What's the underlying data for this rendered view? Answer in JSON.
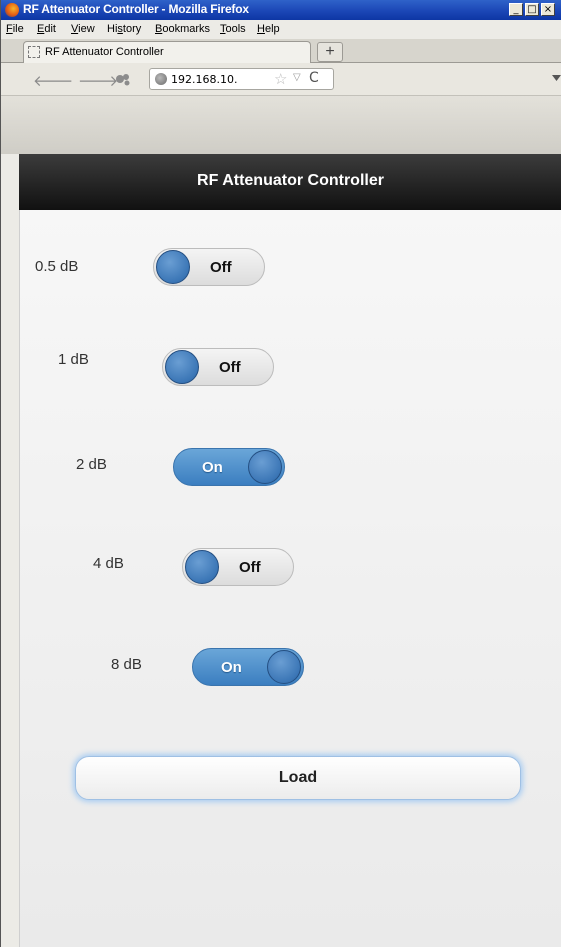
{
  "window": {
    "title": "RF Attenuator Controller - Mozilla Firefox",
    "controls": [
      "_",
      "□",
      "×"
    ]
  },
  "menubar": {
    "items": [
      {
        "first": "F",
        "rest": "ile"
      },
      {
        "first": "E",
        "rest": "dit"
      },
      {
        "first": "V",
        "rest": "iew"
      },
      {
        "first": "Hi",
        "u": "s",
        "rest": "tory"
      },
      {
        "first": "B",
        "rest": "ookmarks"
      },
      {
        "first": "T",
        "rest": "ools"
      },
      {
        "first": "H",
        "rest": "elp"
      }
    ]
  },
  "tabs": {
    "active_tab": "RF Attenuator Controller",
    "new_tab": "+"
  },
  "navbar": {
    "back_icon": "🡐",
    "forward_icon": "🡒",
    "url": "192.168.10.",
    "star_icon": "☆",
    "dropdown_icon": "▽",
    "reload_icon": "C"
  },
  "page": {
    "header_title": "RF Attenuator Controller",
    "attenuators": [
      {
        "label": "0.5 dB",
        "state": "Off"
      },
      {
        "label": "1 dB",
        "state": "Off"
      },
      {
        "label": "2 dB",
        "state": "On"
      },
      {
        "label": "4 dB",
        "state": "Off"
      },
      {
        "label": "8 dB",
        "state": "On"
      }
    ],
    "load_label": "Load"
  }
}
